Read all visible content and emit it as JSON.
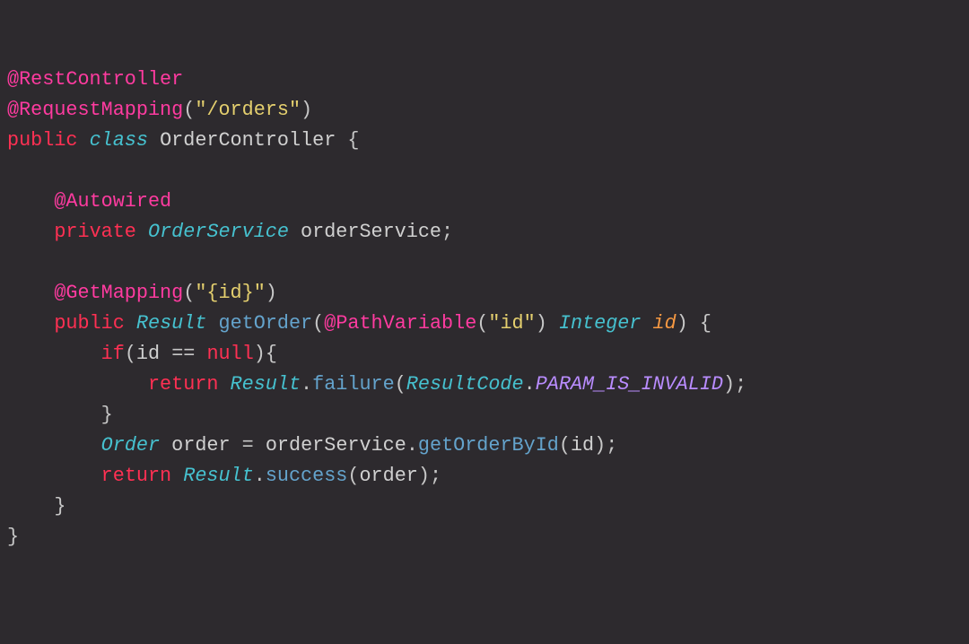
{
  "l1": {
    "ann1": "@RestController"
  },
  "l2": {
    "ann2": "@RequestMapping",
    "lp": "(",
    "s": "\"/orders\"",
    "rp": ")"
  },
  "l3": {
    "kpub": "public",
    "sp1": " ",
    "kclass": "class",
    "sp2": " ",
    "name": "OrderController",
    "sp3": " ",
    "ob": "{"
  },
  "l5": {
    "ind": "    ",
    "ann": "@Autowired"
  },
  "l6": {
    "ind": "    ",
    "kpriv": "private",
    "sp1": " ",
    "type": "OrderService",
    "sp2": " ",
    "name": "orderService",
    "semi": ";"
  },
  "l8": {
    "ind": "    ",
    "ann": "@GetMapping",
    "lp": "(",
    "s": "\"{id}\"",
    "rp": ")"
  },
  "l9": {
    "ind": "    ",
    "kpub": "public",
    "sp1": " ",
    "type": "Result",
    "sp2": " ",
    "meth": "getOrder",
    "lp": "(",
    "ann": "@PathVariable",
    "lp2": "(",
    "s": "\"id\"",
    "rp2": ")",
    "sp3": " ",
    "ptype": "Integer",
    "sp4": " ",
    "pname": "id",
    "rp": ")",
    "sp5": " ",
    "ob": "{"
  },
  "l10": {
    "ind": "        ",
    "kif": "if",
    "lp": "(",
    "v": "id",
    "sp1": " ",
    "eq": "==",
    "sp2": " ",
    "nul": "null",
    "rp": ")",
    "ob": "{"
  },
  "l11": {
    "ind": "            ",
    "kret": "return",
    "sp1": " ",
    "type": "Result",
    "dot": ".",
    "m": "failure",
    "lp": "(",
    "type2": "ResultCode",
    "dot2": ".",
    "c": "PARAM_IS_INVALID",
    "rp": ")",
    "semi": ";"
  },
  "l12": {
    "ind": "        ",
    "cb": "}"
  },
  "l13": {
    "ind": "        ",
    "type": "Order",
    "sp1": " ",
    "v": "order",
    "sp2": " ",
    "eq": "=",
    "sp3": " ",
    "obj": "orderService",
    "dot": ".",
    "m": "getOrderById",
    "lp": "(",
    "arg": "id",
    "rp": ")",
    "semi": ";"
  },
  "l14": {
    "ind": "        ",
    "kret": "return",
    "sp1": " ",
    "type": "Result",
    "dot": ".",
    "m": "success",
    "lp": "(",
    "arg": "order",
    "rp": ")",
    "semi": ";"
  },
  "l15": {
    "ind": "    ",
    "cb": "}"
  },
  "l16": {
    "cb": "}"
  }
}
